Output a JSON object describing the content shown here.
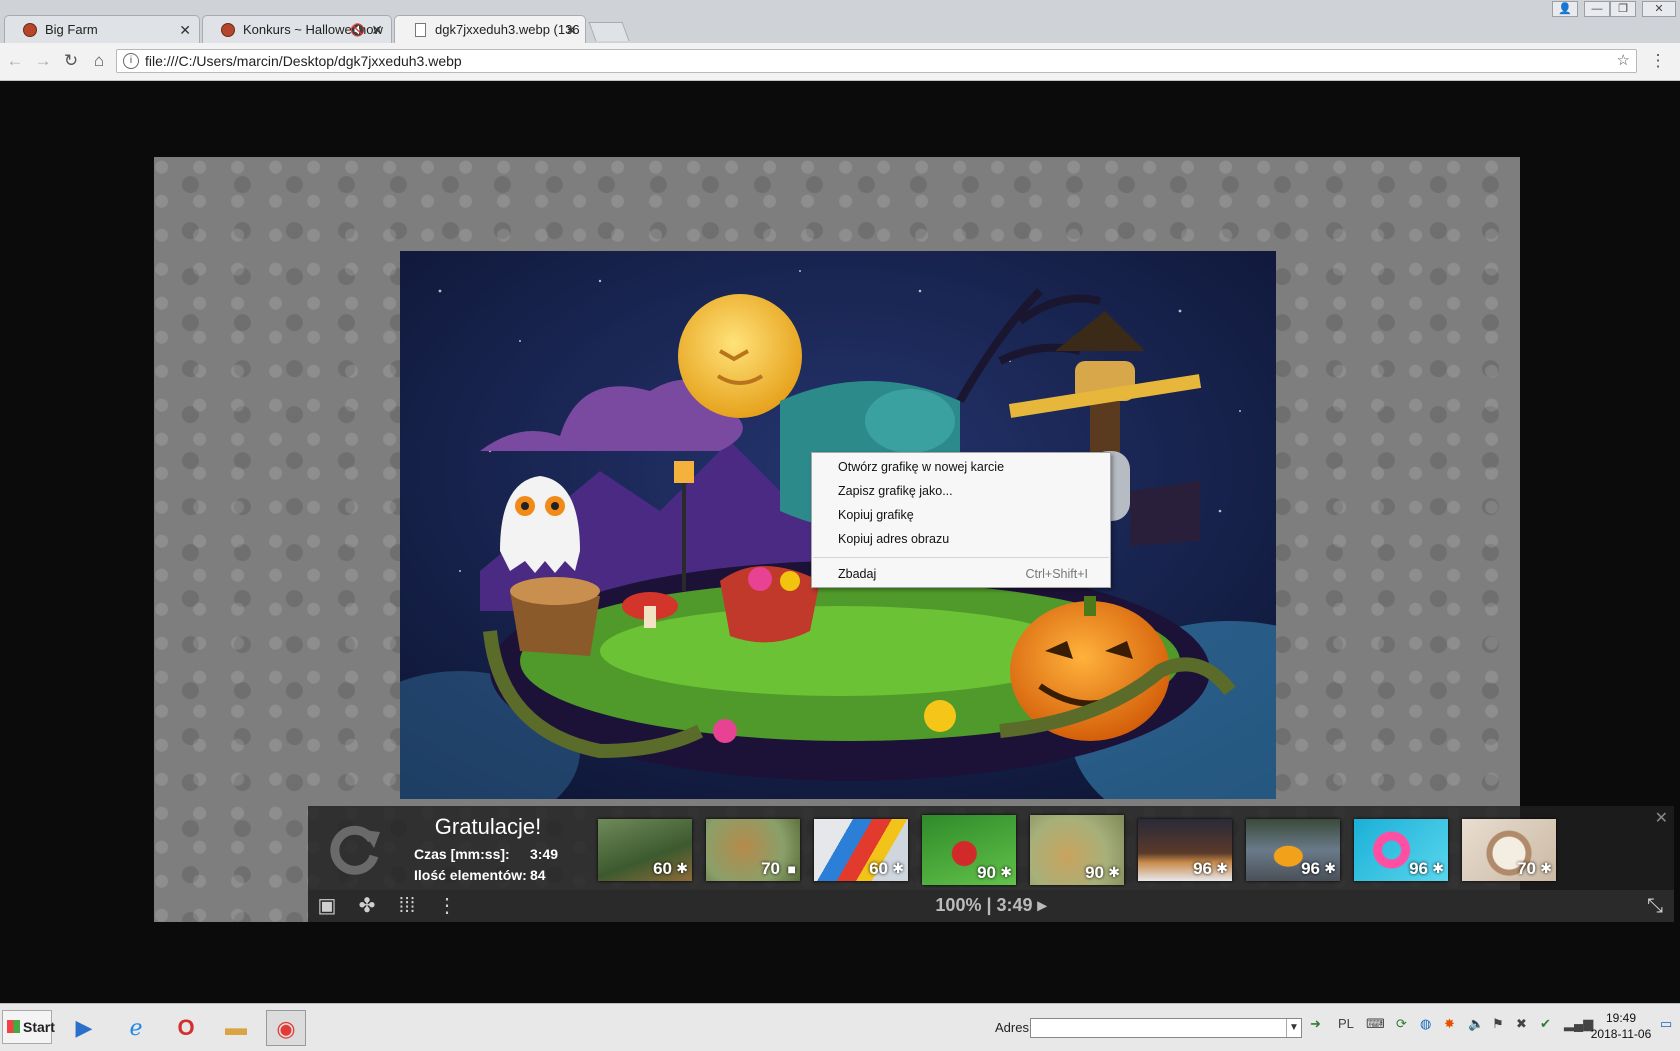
{
  "browser": {
    "tabs": [
      {
        "title": "Big Farm",
        "muted": false
      },
      {
        "title": "Konkurs ~ Halloweenow",
        "muted": true
      },
      {
        "title": "dgk7jxxeduh3.webp (136",
        "muted": false
      }
    ],
    "address": "file:///C:/Users/marcin/Desktop/dgk7jxxeduh3.webp"
  },
  "context_menu": {
    "items": [
      {
        "label": "Otwórz grafikę w nowej karcie",
        "shortcut": ""
      },
      {
        "label": "Zapisz grafikę jako...",
        "shortcut": ""
      },
      {
        "label": "Kopiuj grafikę",
        "shortcut": ""
      },
      {
        "label": "Kopiuj adres obrazu",
        "shortcut": ""
      },
      {
        "label": "Zbadaj",
        "shortcut": "Ctrl+Shift+I"
      }
    ]
  },
  "puzzle_panel": {
    "title": "Gratulacje!",
    "time_label": "Czas [mm:ss]:",
    "time_value": "3:49",
    "pieces_label": "Ilość elementów:",
    "pieces_value": "84",
    "zoom_time": "100% | 3:49 ▸",
    "thumbnails": [
      {
        "count": "60",
        "theme": "village"
      },
      {
        "count": "70",
        "theme": "squirrel"
      },
      {
        "count": "60",
        "theme": "umbrellas"
      },
      {
        "count": "90",
        "theme": "tulips"
      },
      {
        "count": "90",
        "theme": "cheetahs"
      },
      {
        "count": "96",
        "theme": "winter-town"
      },
      {
        "count": "96",
        "theme": "race-car"
      },
      {
        "count": "96",
        "theme": "pool-ring"
      },
      {
        "count": "70",
        "theme": "hot-chocolate"
      }
    ]
  },
  "taskbar": {
    "start_label": "Start",
    "address_label": "Adres",
    "language": "PL",
    "time": "19:49",
    "date": "2018-11-06"
  },
  "colors": {
    "viewer_bg": "#7e7e7e",
    "night_sky": "#15204a",
    "pumpkin": "#f08a1e",
    "moon": "#f4c542"
  }
}
